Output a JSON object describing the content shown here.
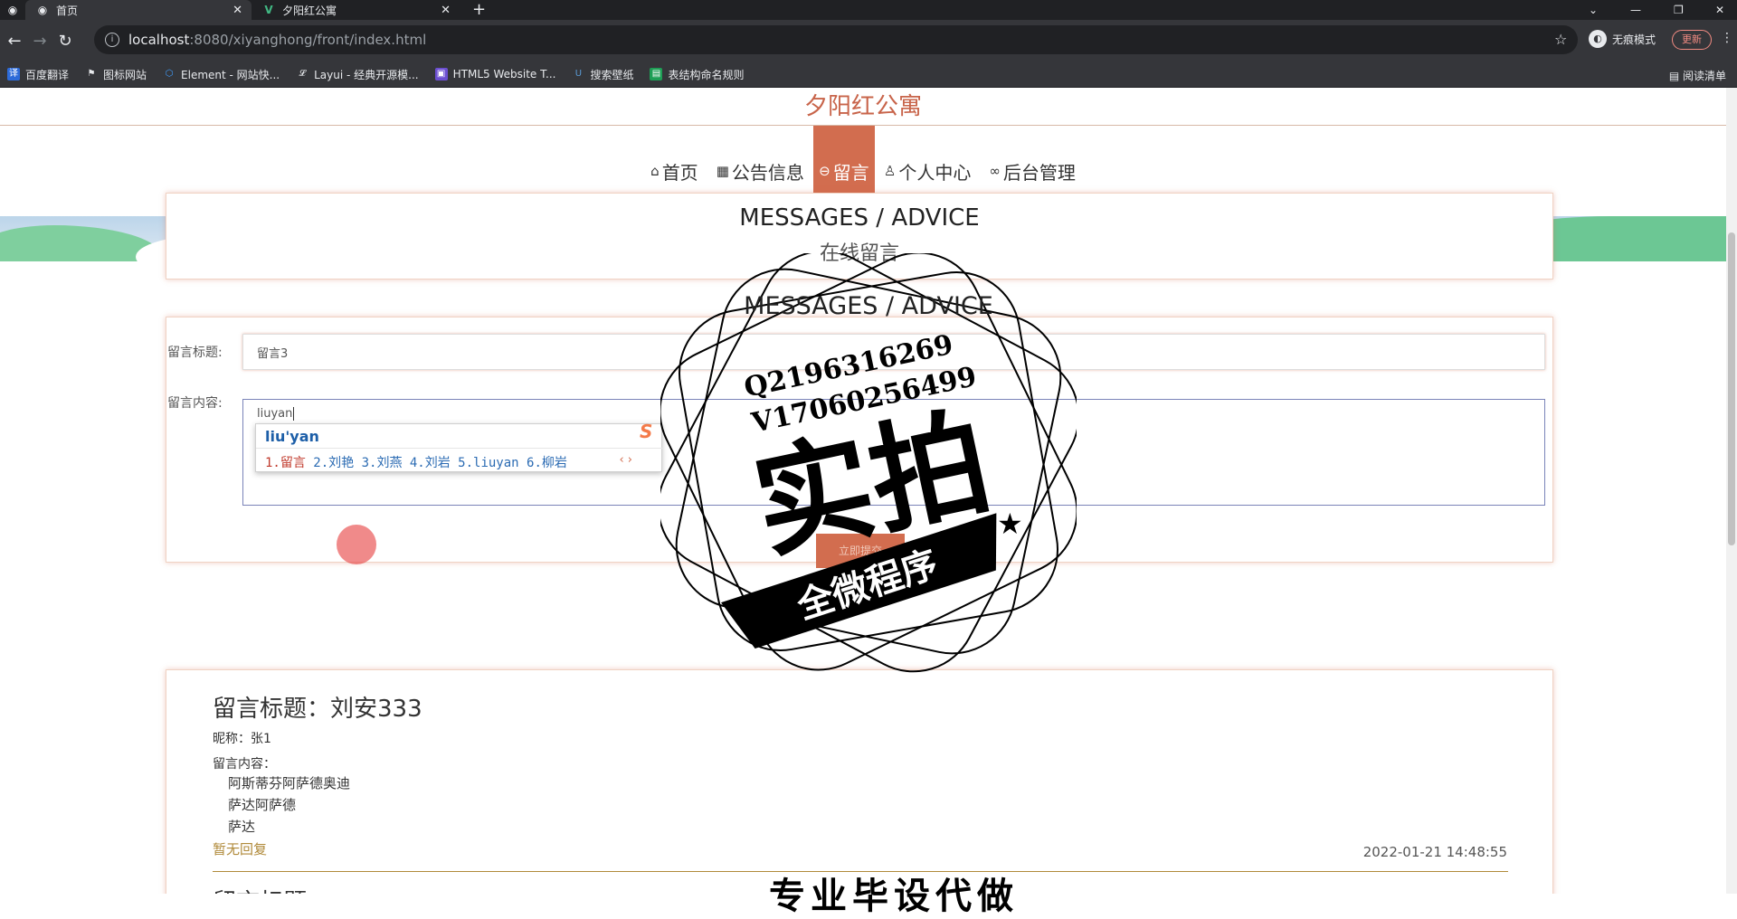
{
  "browser": {
    "tabs": [
      {
        "title": "首页",
        "active": true
      },
      {
        "title": "夕阳红公寓",
        "active": false
      }
    ],
    "new_tab": "+",
    "url_host": "localhost",
    "url_rest": ":8080/xiyanghong/front/index.html",
    "incognito_label": "无痕模式",
    "update_label": "更新",
    "reading_list": "阅读清单",
    "bookmarks": [
      "百度翻译",
      "图标网站",
      "Element - 网站快...",
      "Layui - 经典开源模...",
      "HTML5 Website T...",
      "搜索壁纸",
      "表结构命名规则"
    ]
  },
  "site": {
    "title": "夕阳红公寓",
    "nav": [
      {
        "label": "首页",
        "icon": "home-icon"
      },
      {
        "label": "公告信息",
        "icon": "grid-icon"
      },
      {
        "label": "留言",
        "icon": "message-icon",
        "active": true
      },
      {
        "label": "个人中心",
        "icon": "user-icon"
      },
      {
        "label": "后台管理",
        "icon": "link-icon"
      }
    ]
  },
  "section_head": {
    "en": "MESSAGES / ADVICE",
    "cn": "在线留言"
  },
  "form": {
    "title_label": "留言标题:",
    "title_value": "留言3",
    "content_label": "留言内容:",
    "content_value": "liuyan",
    "submit_label": "立即提交"
  },
  "ime": {
    "pinyin": "liu'yan",
    "candidates_first": "1.留言",
    "candidates_rest": "2.刘艳 3.刘燕 4.刘岩 5.liuyan 6.柳岩",
    "logo": "S",
    "arrows": "‹ ›"
  },
  "message": {
    "title": "留言标题：刘安333",
    "nickname": "昵称：张1",
    "content_label": "留言内容：",
    "content_lines": [
      "阿斯蒂芬阿萨德奥迪",
      "萨达阿萨德",
      "萨达"
    ],
    "no_reply": "暂无回复",
    "time": "2022-01-21 14:48:55",
    "next_title": "留言标题："
  },
  "watermark": {
    "qq": "Q2196316269",
    "vx": "V17060256499",
    "big": "实拍",
    "ribbon": "全微程序",
    "bottom": "专业毕设代做"
  }
}
